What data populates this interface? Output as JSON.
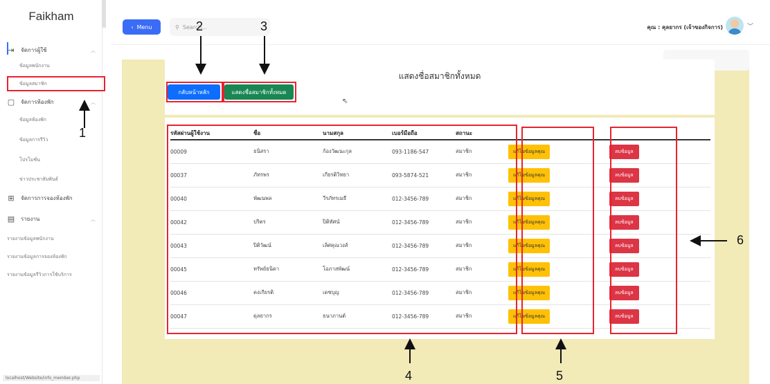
{
  "sidebar": {
    "brand": "Faikham",
    "groups": [
      {
        "label": "จัดการผู้ใช้",
        "icon": "login-icon"
      },
      {
        "label": "จัดการห้องพัก",
        "icon": "document-icon"
      },
      {
        "label": "จัดการการจองห้องพัก",
        "icon": "grid-icon"
      },
      {
        "label": "รายงาน",
        "icon": "table-icon"
      }
    ],
    "items": [
      "ข้อมูลพนักงาน",
      "ข้อมูลสมาชิก",
      "ข้อมูลห้องพัก",
      "ข้อมูลการรีวิว",
      "โปรโมชั่น",
      "ข่าวประชาสัมพันธ์",
      "รายงานข้อมูลพนักงาน",
      "รายงานข้อมูลการจองห้องพัก",
      "รายงานข้อมูลรีวิวการใช้บริการ"
    ],
    "status_url": "localhost/Website/info_member.php"
  },
  "header": {
    "menu_label": "Menu",
    "search_placeholder": "Search...",
    "user_label": "คุณ : คุลยากร (เจ้าของกิจการ)"
  },
  "page": {
    "title": "แสดงชื่อสมาชิกทั้งหมด",
    "home_button": "กลับหน้าหลัก",
    "show_all_button": "แสดงชื่อสมาชิกทั้งหมด"
  },
  "table": {
    "columns": [
      "รหัสผ่านผู้ใช้งาน",
      "ชื่อ",
      "นามสกุล",
      "เบอร์มือถือ",
      "สถานะ"
    ],
    "edit_label": "แก้ไขข้อมูลคุณ",
    "delete_label": "ลบข้อมูล",
    "rows": [
      {
        "id": "00009",
        "first": "ธนิสรา",
        "last": "ก้องวัฒนะกุล",
        "phone": "093-1186-547",
        "status": "สมาชิก"
      },
      {
        "id": "00037",
        "first": "ภัทรพร",
        "last": "เกียรติวิทยา",
        "phone": "093-5874-521",
        "status": "สมาชิก"
      },
      {
        "id": "00040",
        "first": "พัฒนพล",
        "last": "วีรภัทรเมธี",
        "phone": "012-3456-789",
        "status": "สมาชิก"
      },
      {
        "id": "00042",
        "first": "ปริตร",
        "last": "ปิติทัศน์",
        "phone": "012-3456-789",
        "status": "สมาชิก"
      },
      {
        "id": "00043",
        "first": "ปิติวัฒน์",
        "last": "เลิศคุณวงส์",
        "phone": "012-3456-789",
        "status": "สมาชิก"
      },
      {
        "id": "00045",
        "first": "ทรัพย์ธนิดา",
        "last": "โอภาสพัฒน์",
        "phone": "012-3456-789",
        "status": "สมาชิก"
      },
      {
        "id": "00046",
        "first": "คงเกียรติ",
        "last": "เดชบุญ",
        "phone": "012-3456-789",
        "status": "สมาชิก"
      },
      {
        "id": "00047",
        "first": "ดุลยากร",
        "last": "ธนาภานต์",
        "phone": "012-3456-789",
        "status": "สมาชิก"
      }
    ]
  },
  "annotations": {
    "n1": "1",
    "n2": "2",
    "n3": "3",
    "n4": "4",
    "n5": "5",
    "n6": "6",
    "color": "#e8222e"
  }
}
